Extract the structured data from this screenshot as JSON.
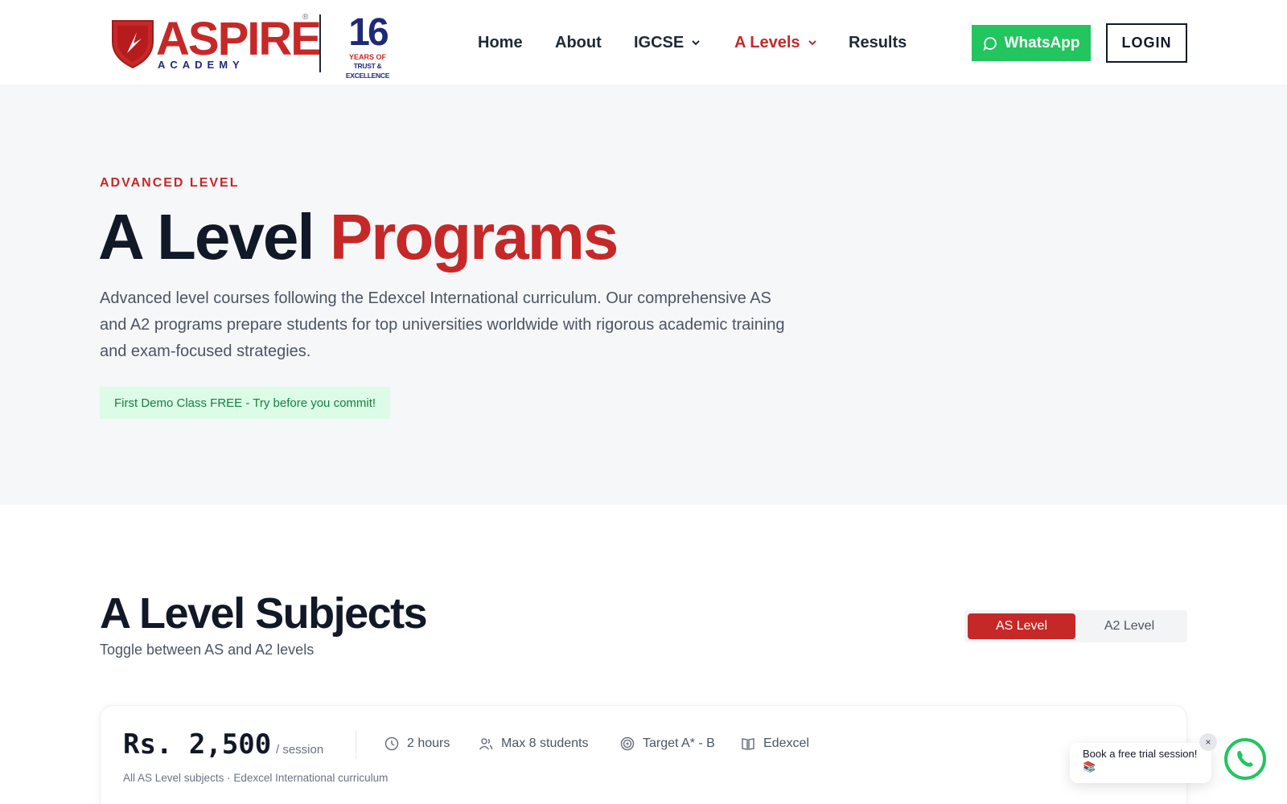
{
  "brand": {
    "name": "ASPIRE",
    "registered": "®",
    "tagline": "ACADEMY",
    "years_number": "16",
    "years_of": "YEARS OF",
    "years_trust": "TRUST & EXCELLENCE",
    "accent_color": "#c62828",
    "navy_color": "#1e2a78"
  },
  "nav": {
    "items": [
      {
        "label": "Home",
        "has_dropdown": false,
        "active": false
      },
      {
        "label": "About",
        "has_dropdown": false,
        "active": false
      },
      {
        "label": "IGCSE",
        "has_dropdown": true,
        "active": false
      },
      {
        "label": "A Levels",
        "has_dropdown": true,
        "active": true
      },
      {
        "label": "Results",
        "has_dropdown": false,
        "active": false
      }
    ],
    "whatsapp_label": "WhatsApp",
    "login_label": "LOGIN"
  },
  "hero": {
    "eyebrow": "ADVANCED LEVEL",
    "title_main": "A Level",
    "title_accent": "Programs",
    "description": "Advanced level courses following the Edexcel International curriculum. Our comprehensive AS and A2 programs prepare students for top universities worldwide with rigorous academic training and exam-focused strategies.",
    "promo": "First Demo Class FREE - Try before you commit!"
  },
  "subjects": {
    "title": "A Level Subjects",
    "subtitle": "Toggle between AS and A2 levels",
    "toggle": [
      {
        "label": "AS Level",
        "active": true
      },
      {
        "label": "A2 Level",
        "active": false
      }
    ],
    "card": {
      "price": "Rs. 2,500",
      "per": "/ session",
      "meta": [
        {
          "icon": "clock-icon",
          "label": "2 hours"
        },
        {
          "icon": "users-icon",
          "label": "Max 8 students"
        },
        {
          "icon": "target-icon",
          "label": "Target A* - B"
        },
        {
          "icon": "book-icon",
          "label": "Edexcel"
        }
      ],
      "note": "All AS Level subjects · Edexcel International curriculum"
    }
  },
  "chat": {
    "bubble": "Book a free trial session! 📚",
    "close": "×"
  }
}
